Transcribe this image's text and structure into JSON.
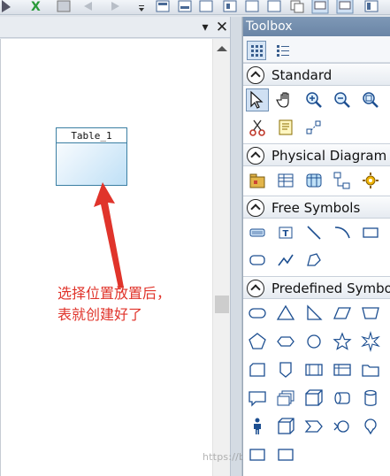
{
  "canvas": {
    "table_title": "Table_1",
    "annotation_line1": "选择位置放置后，",
    "annotation_line2": "表就创建好了"
  },
  "window": {
    "pin": "▾",
    "close": "✕"
  },
  "toolbox": {
    "title": "Toolbox",
    "sections": {
      "standard": "Standard",
      "physical_diagram": "Physical Diagram",
      "free_symbols": "Free Symbols",
      "predefined_symbols": "Predefined Symbols"
    }
  },
  "watermark": "https://blog.csdn.net/Lw0908",
  "colors": {
    "annotation": "#e0342b",
    "toolbox_header": "#7e98b6",
    "table_border": "#3b7fa3"
  }
}
